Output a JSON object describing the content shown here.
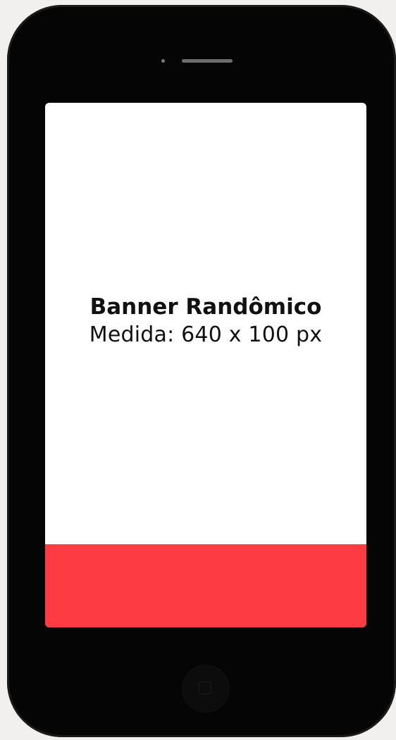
{
  "banner": {
    "title": "Banner Randômico",
    "size_label": "Medida: 640 x 100 px"
  },
  "icons": {
    "home_button": "home-button-icon",
    "camera": "camera-icon",
    "speaker": "speaker-icon"
  },
  "colors": {
    "phone_body": "#050505",
    "screen": "#ffffff",
    "ad_strip": "#fc3b43"
  }
}
